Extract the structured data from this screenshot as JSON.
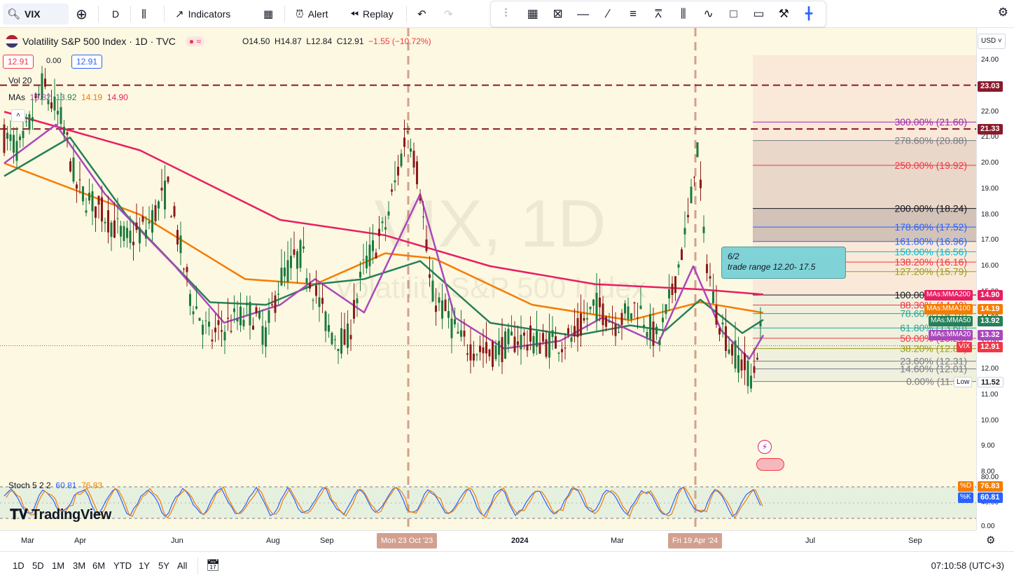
{
  "toolbar": {
    "symbol": "VIX",
    "interval": "D",
    "indicators": "Indicators",
    "alert": "Alert",
    "replay": "Replay"
  },
  "legend": {
    "title": "Volatility S&P 500 Index · 1D · TVC",
    "open": "O14.50",
    "high": "H14.87",
    "low": "L12.84",
    "close": "C12.91",
    "change": "−1.55 (−10.72%)",
    "bid": "12.91",
    "spread": "0.00",
    "ask": "12.91"
  },
  "vol_label": "Vol 20",
  "mas": {
    "label": "MAs",
    "values": [
      "13.32",
      "13.92",
      "14.19",
      "14.90"
    ],
    "colors": [
      "#ab47bc",
      "#26805a",
      "#f57c00",
      "#e91e63"
    ]
  },
  "stoch": {
    "label": "Stoch 5 2 2",
    "k": "60.81",
    "d": "76.83"
  },
  "watermark": "VIX, 1D",
  "watermark_sub": "Volatility S&P 500 Index",
  "callout": {
    "line1": "6/2",
    "line2": "trade range 12.20- 17.5"
  },
  "fib_levels": [
    {
      "label": "300.00% (21.60)",
      "price": 21.6,
      "color": "#9c27b0"
    },
    {
      "label": "278.60% (20.88)",
      "price": 20.88,
      "color": "#787b86"
    },
    {
      "label": "250.00% (19.92)",
      "price": 19.92,
      "color": "#f23645"
    },
    {
      "label": "200.00% (18.24)",
      "price": 18.24,
      "color": "#131722"
    },
    {
      "label": "178.60% (17.52)",
      "price": 17.52,
      "color": "#2962ff"
    },
    {
      "label": "161.80% (16.96)",
      "price": 16.96,
      "color": "#2962ff"
    },
    {
      "label": "150.00% (16.56)",
      "price": 16.56,
      "color": "#00bcd4"
    },
    {
      "label": "138.20% (16.16)",
      "price": 16.16,
      "color": "#f23645"
    },
    {
      "label": "127.20% (15.79)",
      "price": 15.79,
      "color": "#9c9c1a"
    },
    {
      "label": "100.00% (14.88)",
      "price": 14.88,
      "color": "#131722"
    },
    {
      "label": "88.30% (14.49)",
      "price": 14.49,
      "color": "#f23645"
    },
    {
      "label": "78.60% (14.16)",
      "price": 14.16,
      "color": "#26a69a"
    },
    {
      "label": "61.80% (13.60)",
      "price": 13.6,
      "color": "#26a69a"
    },
    {
      "label": "50.00% (13.20)",
      "price": 13.2,
      "color": "#f23645"
    },
    {
      "label": "38.20% (12.80)",
      "price": 12.8,
      "color": "#9c9c1a"
    },
    {
      "label": "23.60% (12.31)",
      "price": 12.31,
      "color": "#787b86"
    },
    {
      "label": "14.60% (12.01)",
      "price": 12.01,
      "color": "#787b86"
    },
    {
      "label": "0.00% (11.52)",
      "price": 11.52,
      "color": "#787b86"
    }
  ],
  "price_axis": {
    "currency": "USD",
    "ticks": [
      "24.00",
      "23.00",
      "22.00",
      "21.00",
      "20.00",
      "19.00",
      "18.00",
      "17.00",
      "16.00",
      "15.00",
      "14.00",
      "13.00",
      "12.00",
      "11.00",
      "10.00",
      "9.00",
      "8.00"
    ],
    "stoch_ticks": [
      "80.00",
      "40.00",
      "0.00"
    ]
  },
  "axis_labels": {
    "h1": "23.03",
    "h2": "21.33",
    "ma200": "14.90",
    "ma100": "14.19",
    "ma50": "13.92",
    "ma20": "13.32",
    "vix": "12.91",
    "low": "11.52",
    "d": "76.83",
    "k": "60.81",
    "ma200_name": "MAs:MMA200",
    "ma100_name": "MAs:MMA100",
    "ma50_name": "MAs:MMA50",
    "ma20_name": "MAs:MMA20",
    "vix_name": "VIX",
    "low_name": "Low",
    "d_name": "%D",
    "k_name": "%K"
  },
  "time_axis": {
    "labels": [
      "Mar",
      "Apr",
      "Jun",
      "Aug",
      "Sep",
      "2024",
      "Mar",
      "Jul",
      "Sep"
    ],
    "highlight1": "Mon 23 Oct '23",
    "highlight2": "Fri 19 Apr '24"
  },
  "ranges": [
    "1D",
    "5D",
    "1M",
    "3M",
    "6M",
    "YTD",
    "1Y",
    "5Y",
    "All"
  ],
  "clock": "07:10:58 (UTC+3)",
  "logo": "TradingView"
}
